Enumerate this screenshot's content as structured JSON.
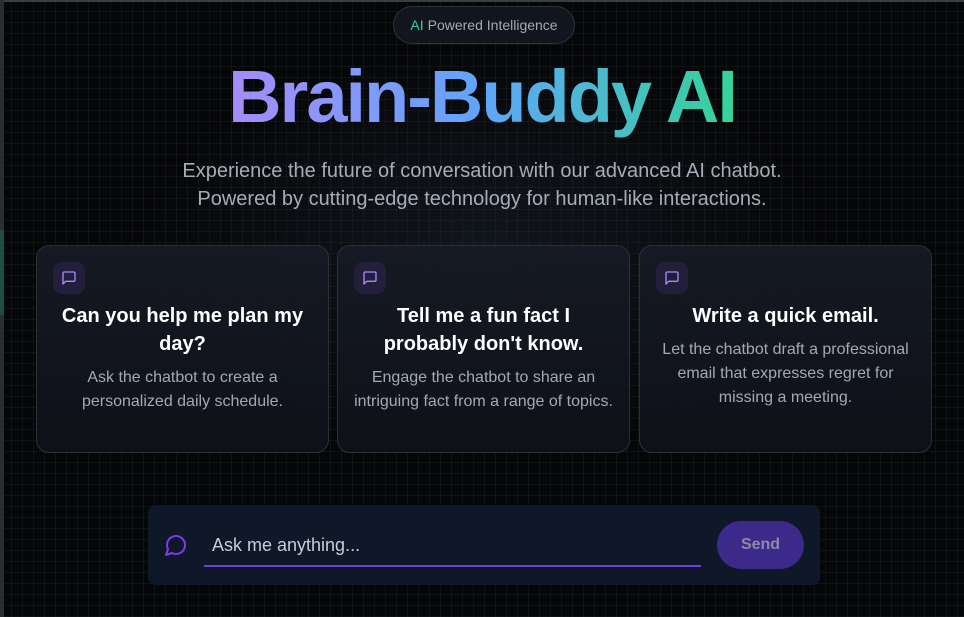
{
  "badge": {
    "highlight": "AI",
    "text": "Powered Intelligence"
  },
  "hero": {
    "title": "Brain-Buddy AI",
    "subtitle_line1": "Experience the future of conversation with our advanced AI chatbot.",
    "subtitle_line2": "Powered by cutting-edge technology for human-like interactions."
  },
  "cards": [
    {
      "icon": "message-square-icon",
      "title": "Can you help me plan my day?",
      "description": "Ask the chatbot to create a personalized daily schedule."
    },
    {
      "icon": "message-square-icon",
      "title": "Tell me a fun fact I probably don't know.",
      "description": "Engage the chatbot to share an intriguing fact from a range of topics."
    },
    {
      "icon": "message-square-icon",
      "title": "Write a quick email.",
      "description": "Let the chatbot draft a professional email that expresses regret for missing a meeting."
    }
  ],
  "chat": {
    "icon": "message-circle-icon",
    "placeholder": "Ask me anything...",
    "value": "",
    "send_label": "Send"
  },
  "colors": {
    "accent_purple": "#7c3aed",
    "accent_green": "#34d399",
    "accent_blue": "#60a5fa",
    "background": "#050607"
  }
}
